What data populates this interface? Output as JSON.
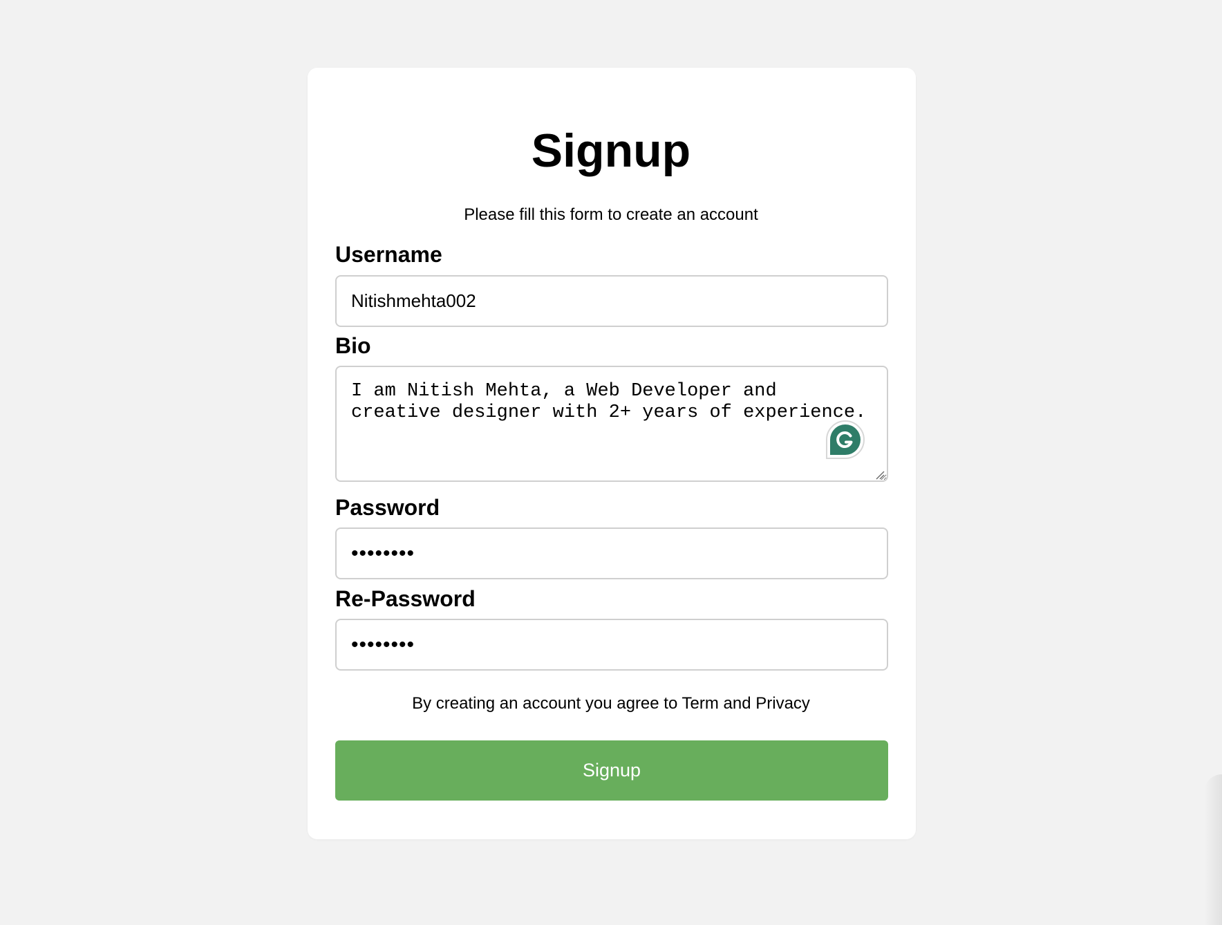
{
  "form": {
    "title": "Signup",
    "subtitle": "Please fill this form to create an account",
    "username": {
      "label": "Username",
      "value": "Nitishmehta002"
    },
    "bio": {
      "label": "Bio",
      "value": "I am Nitish Mehta, a Web Developer and creative designer with 2+ years of experience."
    },
    "password": {
      "label": "Password",
      "value": "••••••••"
    },
    "re_password": {
      "label": "Re-Password",
      "value": "••••••••"
    },
    "terms_text": "By creating an account you agree to Term and Privacy",
    "submit_label": "Signup"
  },
  "icons": {
    "grammarly": "grammarly-icon",
    "resize": "resize-handle-icon"
  },
  "colors": {
    "background": "#f2f2f2",
    "card": "#ffffff",
    "button": "#68ae5c",
    "grammarly": "#2f7d68",
    "input_border": "#cfcfcf"
  }
}
